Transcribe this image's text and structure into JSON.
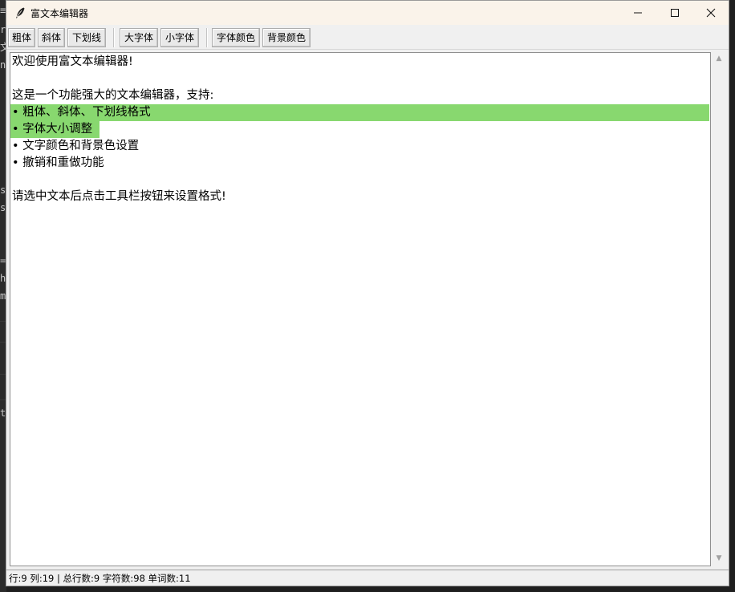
{
  "background_strip": {
    "chars": [
      "≡",
      "r",
      "文",
      "n",
      "",
      "",
      "",
      "",
      "",
      "",
      "s",
      "s",
      "",
      "",
      "=",
      "h",
      "m"
    ],
    "char_t": "t"
  },
  "window": {
    "title": "富文本编辑器",
    "controls": {
      "minimize": "minimize-icon",
      "maximize": "maximize-icon",
      "close": "close-icon"
    }
  },
  "toolbar": {
    "groups": [
      [
        {
          "id": "bold",
          "label": "粗体"
        },
        {
          "id": "italic",
          "label": "斜体"
        },
        {
          "id": "underline",
          "label": "下划线"
        }
      ],
      [
        {
          "id": "bigger",
          "label": "大字体"
        },
        {
          "id": "smaller",
          "label": "小字体"
        }
      ],
      [
        {
          "id": "font-color",
          "label": "字体颜色"
        },
        {
          "id": "bg-color",
          "label": "背景颜色"
        }
      ]
    ]
  },
  "editor": {
    "lines": [
      "欢迎使用富文本编辑器!",
      "",
      "这是一个功能强大的文本编辑器，支持:",
      "• 粗体、斜体、下划线格式",
      "• 字体大小调整",
      "• 文字颜色和背景色设置",
      "• 撤销和重做功能",
      "",
      "请选中文本后点击工具栏按钮来设置格式!"
    ],
    "highlight_color": "#88d86f",
    "highlighted_lines": [
      3,
      4
    ]
  },
  "status": {
    "text": "行:9 列:19 | 总行数:9 字符数:98 单词数:11"
  }
}
